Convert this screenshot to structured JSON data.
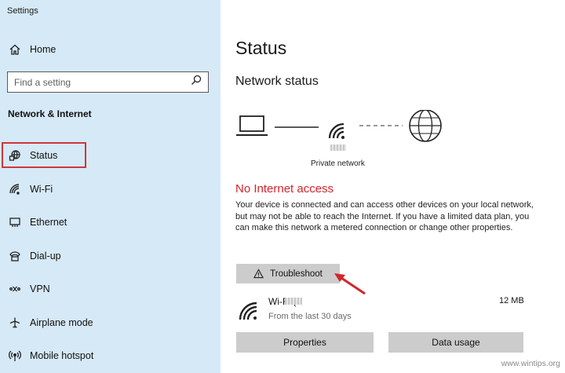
{
  "window": {
    "title": "Settings"
  },
  "sidebar": {
    "home_label": "Home",
    "search_placeholder": "Find a setting",
    "section_title": "Network & Internet",
    "items": [
      {
        "label": "Status",
        "icon": "status-globe-icon",
        "selected": true
      },
      {
        "label": "Wi-Fi",
        "icon": "wifi-icon"
      },
      {
        "label": "Ethernet",
        "icon": "ethernet-icon"
      },
      {
        "label": "Dial-up",
        "icon": "dialup-icon"
      },
      {
        "label": "VPN",
        "icon": "vpn-icon"
      },
      {
        "label": "Airplane mode",
        "icon": "airplane-icon"
      },
      {
        "label": "Mobile hotspot",
        "icon": "hotspot-icon"
      }
    ]
  },
  "main": {
    "title": "Status",
    "subtitle": "Network status",
    "network_label": "Private network",
    "status_heading": "No Internet access",
    "status_description": "Your device is connected and can access other devices on your local network, but may not be able to reach the Internet. If you have a limited data plan, you can make this network a metered connection or change other properties.",
    "troubleshoot_label": "Troubleshoot",
    "connection": {
      "name": "Wi-Fi (",
      "subtitle": "From the last 30 days",
      "usage": "12 MB"
    },
    "properties_label": "Properties",
    "data_usage_label": "Data usage"
  },
  "watermark": "www.wintips.org",
  "colors": {
    "sidebar_bg": "#d6e9f6",
    "error_red": "#d1262b",
    "highlight_red": "#d0363b",
    "button_gray": "#cccccc"
  }
}
